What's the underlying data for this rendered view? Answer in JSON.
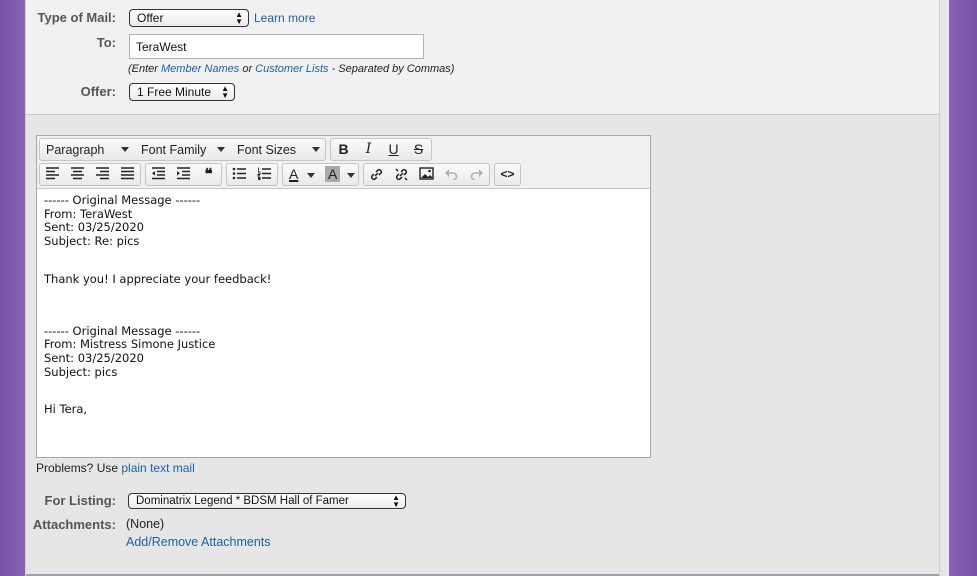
{
  "form": {
    "type_of_mail_label": "Type of Mail:",
    "type_of_mail_value": "Offer",
    "learn_more": "Learn more",
    "to_label": "To:",
    "to_value": "TeraWest",
    "hint_prefix": "(Enter ",
    "hint_member_names": "Member Names",
    "hint_or": " or ",
    "hint_customer_lists": "Customer Lists",
    "hint_suffix": " - Separated by Commas)",
    "offer_label": "Offer:",
    "offer_value": "1 Free Minute"
  },
  "editor": {
    "toolbar": {
      "paragraph": "Paragraph",
      "font_family": "Font Family",
      "font_sizes": "Font Sizes",
      "bold": "B",
      "italic": "I",
      "underline": "U",
      "strikethrough": "S",
      "blockquote": "66",
      "font_color": "A",
      "background_color": "A",
      "source_code": "<>"
    },
    "body_lines": [
      "------ Original Message ------",
      "From: TeraWest",
      "Sent: 03/25/2020",
      "Subject: Re: pics",
      "Thank you! I appreciate your feedback!",
      "------ Original Message ------",
      "From: Mistress Simone Justice",
      "Sent: 03/25/2020",
      "Subject: pics",
      "Hi Tera,"
    ]
  },
  "problems": {
    "prefix": "Problems? Use ",
    "link": "plain text mail"
  },
  "listing": {
    "label": "For Listing:",
    "value": "Dominatrix Legend * BDSM Hall of Famer"
  },
  "attachments": {
    "label": "Attachments:",
    "value": "(None)",
    "link": "Add/Remove Attachments"
  }
}
